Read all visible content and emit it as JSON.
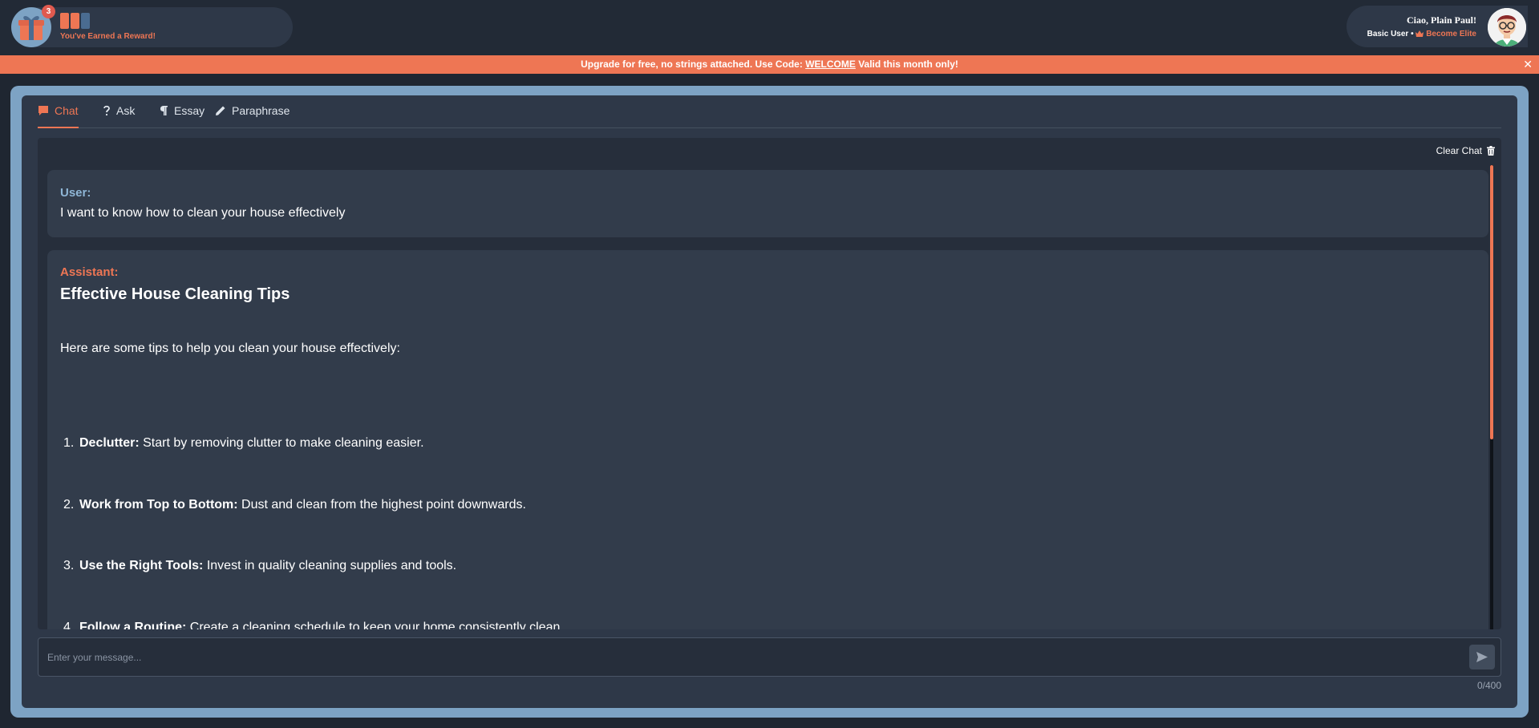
{
  "header": {
    "reward_badge": "3",
    "reward_text": "You've Earned a Reward!",
    "reward_colors": [
      "#ee7654",
      "#ee7654",
      "#4a6c91"
    ],
    "greeting": "Ciao, Plain Paul!",
    "user_tier": "Basic User",
    "separator": "•",
    "become_elite": "Become Elite"
  },
  "promo": {
    "text_before": "Upgrade for free, no strings attached. Use Code: ",
    "code": "WELCOME",
    "text_after": " Valid this month only!",
    "close": "✕"
  },
  "tabs": [
    {
      "label": "Chat",
      "icon": "chat-bubble-icon",
      "active": true
    },
    {
      "label": "Ask",
      "icon": "question-icon",
      "active": false
    },
    {
      "label": "Essay",
      "icon": "paragraph-icon",
      "active": false
    },
    {
      "label": "Paraphrase",
      "icon": "pencil-icon",
      "active": false
    }
  ],
  "chat": {
    "clear_label": "Clear Chat",
    "messages": [
      {
        "role": "User:",
        "text": "I want to know how to clean your house effectively"
      },
      {
        "role": "Assistant:",
        "title": "Effective House Cleaning Tips",
        "intro": "Here are some tips to help you clean your house effectively:",
        "tips": [
          {
            "num": "1.",
            "bold": "Declutter:",
            "text": " Start by removing clutter to make cleaning easier."
          },
          {
            "num": "2.",
            "bold": "Work from Top to Bottom:",
            "text": " Dust and clean from the highest point downwards."
          },
          {
            "num": "3.",
            "bold": "Use the Right Tools:",
            "text": " Invest in quality cleaning supplies and tools."
          },
          {
            "num": "4.",
            "bold": "Follow a Routine:",
            "text": " Create a cleaning schedule to keep your home consistently clean."
          }
        ]
      }
    ]
  },
  "composer": {
    "placeholder": "Enter your message...",
    "value": "",
    "counter": "0/400"
  },
  "colors": {
    "accent": "#ee7654",
    "user_role": "#8fb6d6",
    "frame": "#7da3c4"
  }
}
